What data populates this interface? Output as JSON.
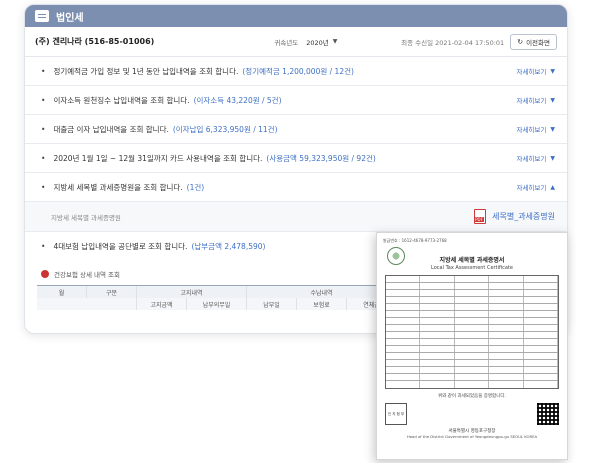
{
  "header": {
    "title": "법인세"
  },
  "toolbar": {
    "company": "(주) 겐리나라 (516-85-01006)",
    "year_label": "귀속년도",
    "year_value": "2020년",
    "received": "최종 수신일 2021-02-04 17:50:01",
    "refresh_label": "이전화면"
  },
  "rows": [
    {
      "text": "정기예적금 가입 정보 및 1년 동안 납입내역을 조회 합니다.",
      "highlight": "(정기예적금 1,200,000원 / 12건)",
      "more": "자세히보기",
      "expanded": false
    },
    {
      "text": "이자소득 원천징수 납입내역을 조회 합니다.",
      "highlight": "(이자소득 43,220원 / 5건)",
      "more": "자세히보기",
      "expanded": false
    },
    {
      "text": "대출금 이자 납입내역을 조회 합니다.",
      "highlight": "(이자납입 6,323,950원 / 11건)",
      "more": "자세히보기",
      "expanded": false
    },
    {
      "text": "2020년 1월 1일 ~ 12월 31일까지 카드 사용내역을 조회 합니다.",
      "highlight": "(사용금액 59,323,950원 / 92건)",
      "more": "자세히보기",
      "expanded": false
    },
    {
      "text": "지방세 세목별 과세증명원을 조회 합니다.",
      "highlight": "(1건)",
      "more": "자세히보기",
      "expanded": true
    }
  ],
  "sub_panel": {
    "label": "지방세 세목별 과세증명원",
    "pdf_label": "세목별_과세증명원"
  },
  "health_row": {
    "text": "4대보험 납입내역을 공단별로 조회 합니다.",
    "highlight": "(납부금액 2,478,590)"
  },
  "health_table": {
    "title": "건강보험 상세 내역 조회",
    "headers_top": [
      "월",
      "구분",
      "고지내역",
      "수납내역"
    ],
    "headers_sub": [
      "고지금액",
      "납부의무일",
      "납부일",
      "보험료",
      "연체금"
    ]
  },
  "document": {
    "header": "발급번호 : 1612-4678-9773-2768",
    "title": "지방세 세목별 과세증명서",
    "title_en": "Local Tax Assessment Certificate",
    "footer": "위와 같이 과세되었음을 증명합니다.",
    "stamp": "인 지 첨 부",
    "issuer": "서울특별시 영등포구청장",
    "issuer_en": "Head of the District Government of Yeongdeungpo-gu SEOUL KOREA"
  }
}
